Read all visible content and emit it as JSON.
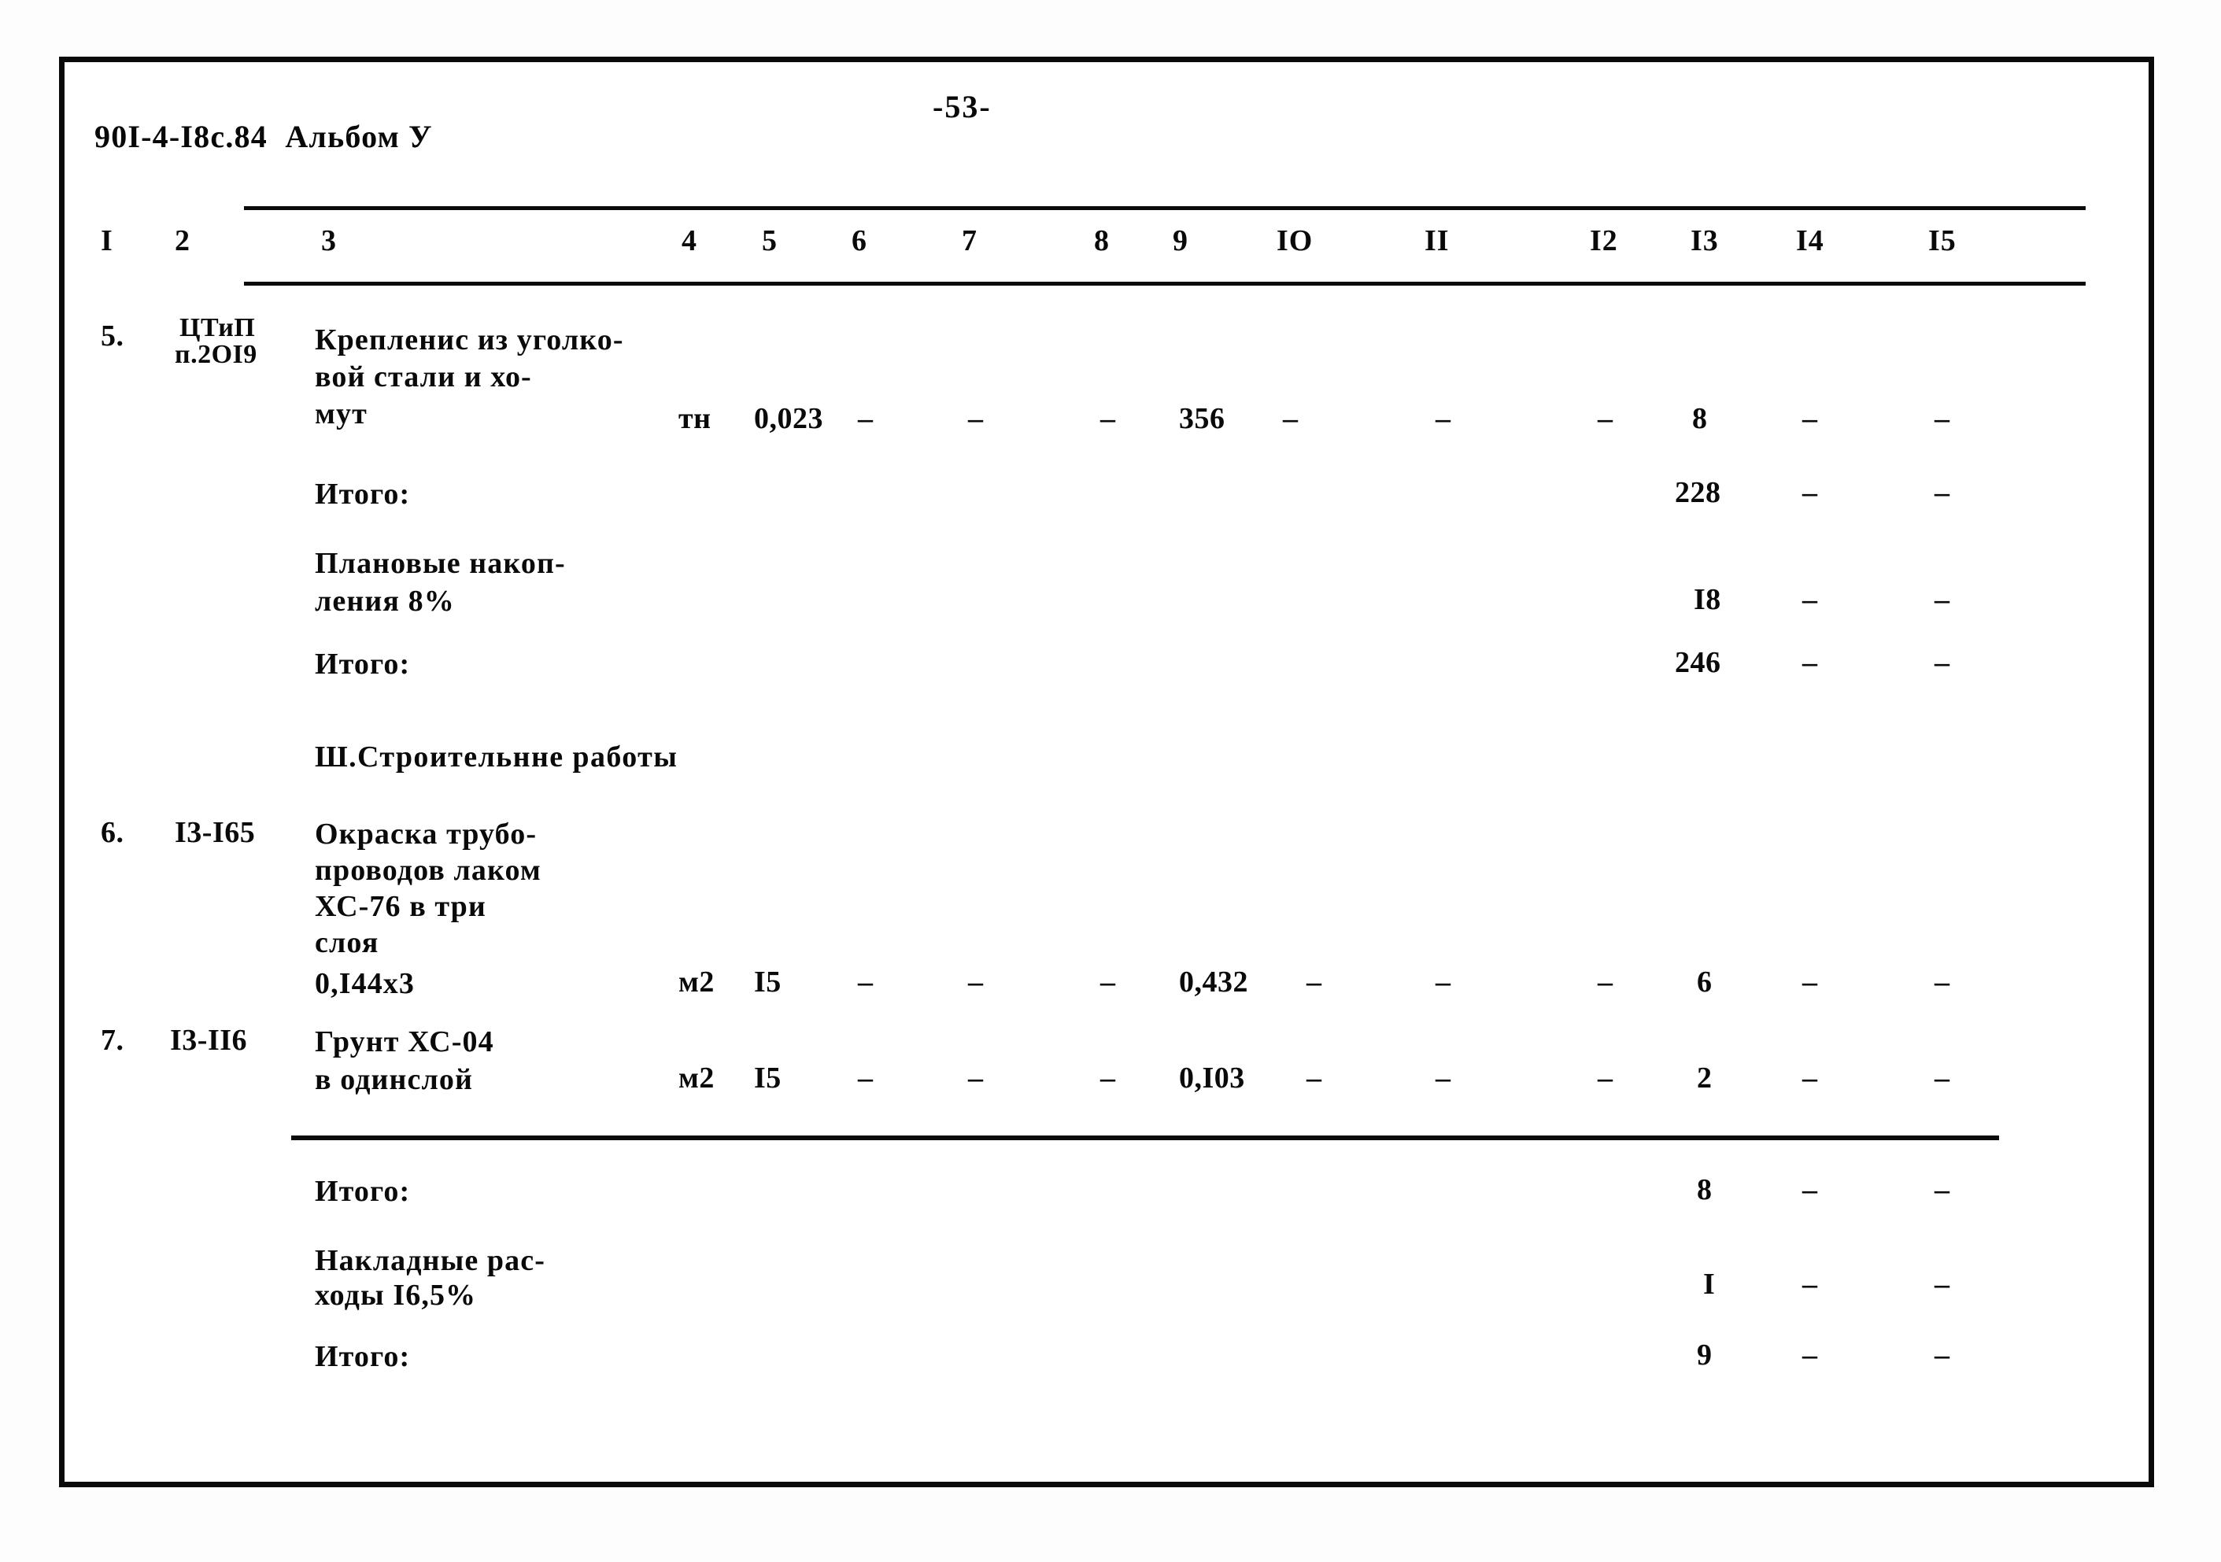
{
  "document": {
    "code": "90I-4-I8с.84  Альбом У",
    "page_number": "-53-"
  },
  "table": {
    "column_headers": [
      "I",
      "2",
      "3",
      "4",
      "5",
      "6",
      "7",
      "8",
      "9",
      "IO",
      "II",
      "I2",
      "I3",
      "I4",
      "I5"
    ],
    "rows": [
      {
        "no": "5.",
        "code": "ЦТиП\nп.2OI9",
        "description": "Крепленис из уголко-\nвой стали и хо-\nмут",
        "unit": "тн",
        "c5": "0,023",
        "c6": "–",
        "c7": "–",
        "c8": "",
        "c9": "–",
        "c10": "356",
        "c11": "–",
        "c12": "–",
        "c13": "–",
        "c14": "8",
        "c15": "–",
        "c16": "–"
      },
      {
        "no": "",
        "code": "",
        "description": "Итого:",
        "unit": "",
        "c14": "228",
        "c15": "–",
        "c16": "–"
      },
      {
        "no": "",
        "code": "",
        "description": "Плановые накоп-\nления 8%",
        "unit": "",
        "c14": "I8",
        "c15": "–",
        "c16": "–"
      },
      {
        "no": "",
        "code": "",
        "description": "Итого:",
        "unit": "",
        "c14": "246",
        "c15": "–",
        "c16": "–"
      },
      {
        "no": "6.",
        "code": "I3-I65",
        "description": "Окраска трубо-\nпроводов лаком\nХС-76 в три\nслоя",
        "sub": "0,I44х3",
        "unit": "м2",
        "c5": "I5",
        "c6": "–",
        "c7": "–",
        "c9": "–",
        "c10": "0,432",
        "c11": "–",
        "c12": "–",
        "c13": "–",
        "c14": "6",
        "c15": "–",
        "c16": "–"
      },
      {
        "no": "7.",
        "code": "I3-II6",
        "description": "Грунт ХС-04\nв одинслой",
        "unit": "м2",
        "c5": "I5",
        "c6": "–",
        "c7": "–",
        "c9": "–",
        "c10": "0,I03",
        "c11": "–",
        "c12": "–",
        "c13": "–",
        "c14": "2",
        "c15": "–",
        "c16": "–"
      },
      {
        "no": "",
        "code": "",
        "description": "Итого:",
        "unit": "",
        "c14": "8",
        "c15": "–",
        "c16": "–"
      },
      {
        "no": "",
        "code": "",
        "description": "Накладные рас-\nходы I6,5%",
        "unit": "",
        "c14": "I",
        "c15": "–",
        "c16": "–"
      },
      {
        "no": "",
        "code": "",
        "description": "Итого:",
        "unit": "",
        "c14": "9",
        "c15": "–",
        "c16": "–"
      }
    ],
    "section_heading": "Ш.Строительнне работы"
  },
  "cells": {
    "r5_no": "5.",
    "r5_code_l1": "ЦТиП",
    "r5_code_l2": "п.2OI9",
    "r5_d1": "Крепленис из уголко-",
    "r5_d2": "вой стали и хо-",
    "r5_d3": "мут",
    "r5_unit": "тн",
    "r5_qty": "0,023",
    "r5_c6": "–",
    "r5_c7": "–",
    "r5_c8": "–",
    "r5_c9": "356",
    "r5_c10": "–",
    "r5_c11": "–",
    "r5_c12": "–",
    "r5_c13": "8",
    "r5_c14": "–",
    "r5_c15": "–",
    "t1_label": "Итого:",
    "t1_c13": "228",
    "t1_c14": "–",
    "t1_c15": "–",
    "pn_l1": "Плановые накоп-",
    "pn_l2": "ления 8%",
    "pn_c13": "I8",
    "pn_c14": "–",
    "pn_c15": "–",
    "t2_label": "Итого:",
    "t2_c13": "246",
    "t2_c14": "–",
    "t2_c15": "–",
    "sect": "Ш.Строительнне работы",
    "r6_no": "6.",
    "r6_code": "I3-I65",
    "r6_d1": "Окраска трубо-",
    "r6_d2": "проводов лаком",
    "r6_d3": "ХС-76 в три",
    "r6_d4": "слоя",
    "r6_d5": "0,I44х3",
    "r6_unit": "м2",
    "r6_qty": "I5",
    "r6_c6": "–",
    "r6_c7": "–",
    "r6_c8": "–",
    "r6_c9": "0,432",
    "r6_c10": "–",
    "r6_c11": "–",
    "r6_c12": "–",
    "r6_c13": "6",
    "r6_c14": "–",
    "r6_c15": "–",
    "r7_no": "7.",
    "r7_code": "I3-II6",
    "r7_d1": "Грунт ХС-04",
    "r7_d2": "в одинслой",
    "r7_unit": "м2",
    "r7_qty": "I5",
    "r7_c6": "–",
    "r7_c7": "–",
    "r7_c8": "–",
    "r7_c9": "0,I03",
    "r7_c10": "–",
    "r7_c11": "–",
    "r7_c12": "–",
    "r7_c13": "2",
    "r7_c14": "–",
    "r7_c15": "–",
    "t3_label": "Итого:",
    "t3_c13": "8",
    "t3_c14": "–",
    "t3_c15": "–",
    "nr_l1": "Накладные рас-",
    "nr_l2": "ходы I6,5%",
    "nr_c13": "I",
    "nr_c14": "–",
    "nr_c15": "–",
    "t4_label": "Итого:",
    "t4_c13": "9",
    "t4_c14": "–",
    "t4_c15": "–"
  }
}
